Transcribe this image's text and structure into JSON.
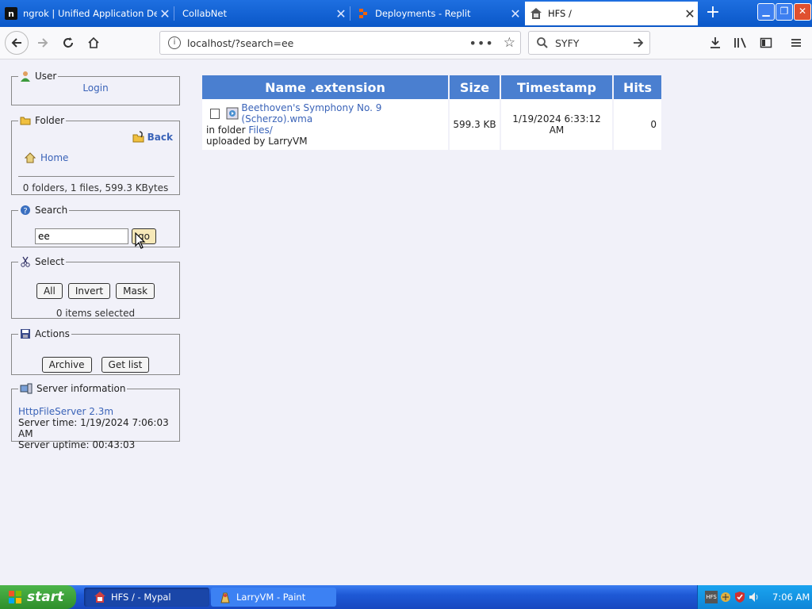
{
  "browser": {
    "tabs": [
      {
        "title": "ngrok | Unified Application Deliver",
        "icon": "ngrok-icon",
        "active": false
      },
      {
        "title": "CollabNet",
        "icon": "none",
        "active": false
      },
      {
        "title": "Deployments - Replit",
        "icon": "replit-icon",
        "active": false
      },
      {
        "title": "HFS /",
        "icon": "hfs-icon",
        "active": true
      }
    ],
    "url": "localhost/?search=ee",
    "search_value": "SYFY"
  },
  "sidebar": {
    "user": {
      "legend": "User",
      "login_link": "Login"
    },
    "folder": {
      "legend": "Folder",
      "back_link": "Back",
      "home_link": "Home",
      "summary": "0 folders, 1 files, 599.3 KBytes"
    },
    "search": {
      "legend": "Search",
      "query": "ee",
      "go_label": "go"
    },
    "select": {
      "legend": "Select",
      "all_label": "All",
      "invert_label": "Invert",
      "mask_label": "Mask",
      "status": "0 items selected"
    },
    "actions": {
      "legend": "Actions",
      "archive_label": "Archive",
      "getlist_label": "Get list"
    },
    "server": {
      "legend": "Server information",
      "version_link": "HttpFileServer 2.3m",
      "server_time": "Server time: 1/19/2024 7:06:03 AM",
      "server_uptime": "Server uptime: 00:43:03"
    }
  },
  "table": {
    "headers": [
      "Name .extension",
      "Size",
      "Timestamp",
      "Hits"
    ],
    "rows": [
      {
        "name": "Beethoven's Symphony No. 9 (Scherzo).wma",
        "in_folder_label": "in folder",
        "folder_link": "Files/",
        "uploaded_by": "uploaded by LarryVM",
        "size": "599.3 KB",
        "timestamp": "1/19/2024 6:33:12 AM",
        "hits": "0"
      }
    ]
  },
  "taskbar": {
    "start_label": "start",
    "items": [
      {
        "title": "HFS / - Mypal",
        "icon": "hfs-icon"
      },
      {
        "title": "LarryVM - Paint",
        "icon": "paint-icon"
      }
    ],
    "clock": "7:06 AM"
  },
  "colors": {
    "tab_strip": "#1e6fe0",
    "table_header": "#4a7fd0",
    "link": "#3a63b8",
    "taskbar": "#1e59d6",
    "start_button": "#3ca23a"
  }
}
